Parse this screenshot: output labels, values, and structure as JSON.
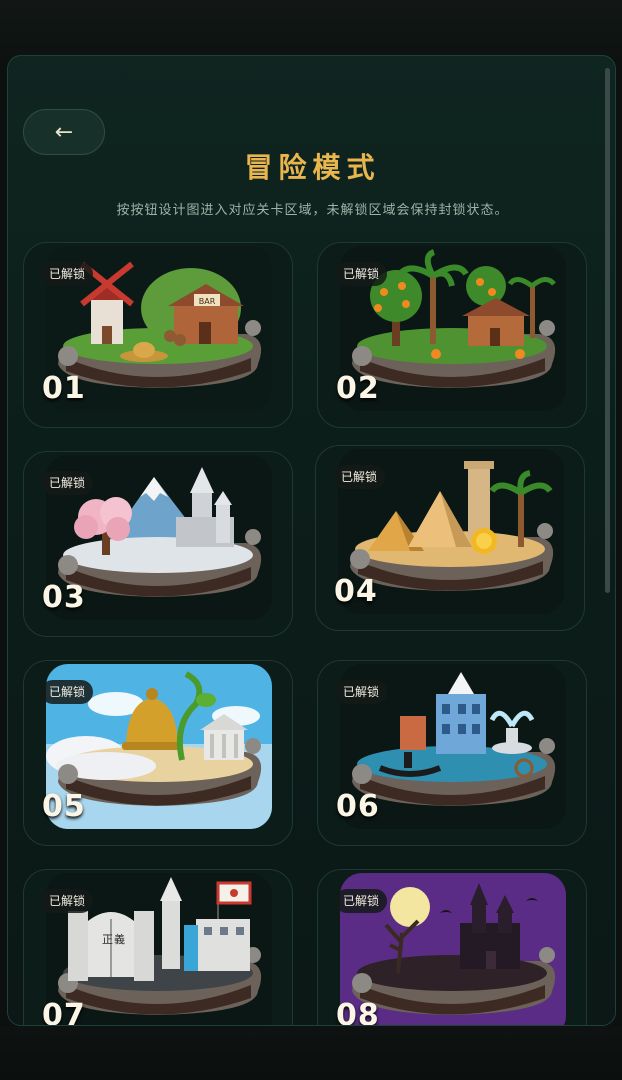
{
  "header": {
    "back_label": "←",
    "title": "冒险模式",
    "subtitle": "按按钮设计图进入对应关卡区域，未解锁区域会保持封锁状态。"
  },
  "levels": [
    {
      "number": "01",
      "status": "已解锁",
      "theme": "windmill-village"
    },
    {
      "number": "02",
      "status": "已解锁",
      "theme": "orange-grove"
    },
    {
      "number": "03",
      "status": "已解锁",
      "theme": "snow-mountain"
    },
    {
      "number": "04",
      "status": "已解锁",
      "theme": "desert-pyramids"
    },
    {
      "number": "05",
      "status": "已解锁",
      "theme": "sky-bell"
    },
    {
      "number": "06",
      "status": "已解锁",
      "theme": "water-city"
    },
    {
      "number": "07",
      "status": "已解锁",
      "theme": "justice-fortress"
    },
    {
      "number": "08",
      "status": "已解锁",
      "theme": "haunted-castle"
    }
  ],
  "colors": {
    "accent": "#e8b54e",
    "panel": "#0f2520",
    "card": "#0c1c19"
  }
}
